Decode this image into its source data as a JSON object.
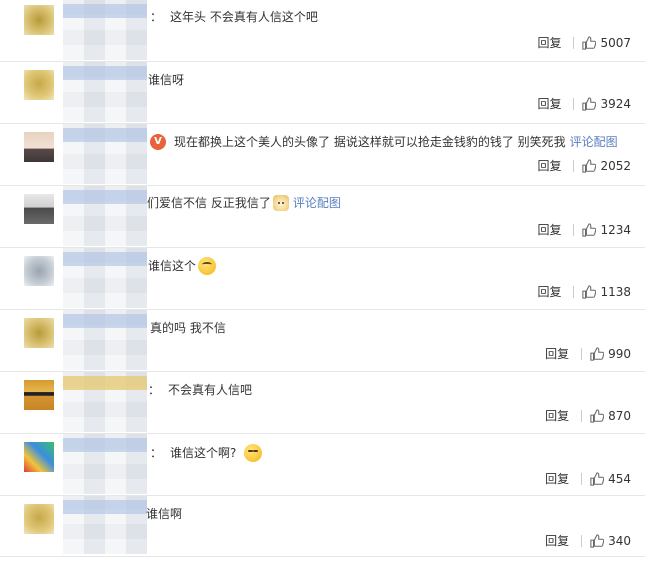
{
  "actions": {
    "reply_label": "回复",
    "view_pic_label": "评论配图"
  },
  "comments": [
    {
      "prefix": "：",
      "text": "这年头 不会真有人信这个吧",
      "likes": "5007"
    },
    {
      "prefix": "",
      "text": "谁信呀",
      "likes": "3924"
    },
    {
      "prefix": "",
      "text": "现在都换上这个美人的头像了 据说这样就可以抢走金钱豹的钱了 别笑死我",
      "likes": "2052",
      "vip": true,
      "has_pic": true
    },
    {
      "prefix": "",
      "text": "们爱信不信 反正我信了",
      "likes": "1234",
      "emoji": "dog-emoji",
      "has_pic": true
    },
    {
      "prefix": "",
      "text": "谁信这个",
      "likes": "1138",
      "emoji": "dizzy-face-emoji"
    },
    {
      "prefix": "",
      "text": "真的吗 我不信",
      "likes": "990"
    },
    {
      "prefix": "：",
      "text": "不会真有人信吧",
      "likes": "870"
    },
    {
      "prefix": "：",
      "text": "谁信这个啊?",
      "likes": "454",
      "emoji": "side-eye-emoji"
    },
    {
      "prefix": "",
      "text": "谁信啊",
      "likes": "340"
    }
  ],
  "avatars": [
    "monkey-avatar",
    "monkey-avatar",
    "kid-avatar",
    "person-avatar",
    "cat-avatar",
    "monkey-avatar",
    "shades-avatar",
    "colorful-avatar",
    "monkey-avatar"
  ],
  "colors": {
    "link": "#5a7fbf",
    "vip_badge": "#e8623a",
    "text": "#333333",
    "separator": "#e6e6e6"
  }
}
